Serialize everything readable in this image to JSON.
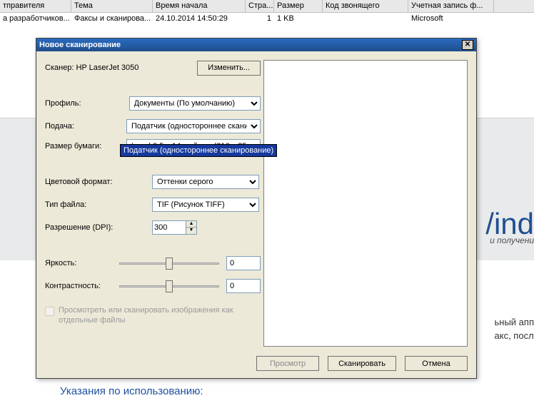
{
  "table": {
    "headers": {
      "sender": "тправителя",
      "subject": "Тема",
      "time": "Время начала",
      "pages": "Стра...",
      "size": "Размер",
      "caller": "Код звонящего",
      "account": "Учетная запись ф..."
    },
    "row": {
      "sender": "а разработчиков...",
      "subject": "Факсы и сканирова...",
      "time": "24.10.2014 14:50:29",
      "pages": "1",
      "size": "1 KB",
      "caller": "",
      "account": "Microsoft"
    }
  },
  "bg": {
    "winText": "/ind",
    "subText": "и получени",
    "para1": "ьный апп",
    "para2": "акс, посл",
    "instructions": "Указания по использованию:"
  },
  "dialog": {
    "title": "Новое сканирование",
    "scannerLabel": "Сканер:",
    "scannerValue": "HP LaserJet 3050",
    "changeBtn": "Изменить...",
    "profileLabel": "Профиль:",
    "profileValue": "Документы (По умолчанию)",
    "feedLabel": "Подача:",
    "feedValue": "Податчик (одностороннее скани",
    "feedOption": "Податчик (одностороннее сканирование)",
    "paperLabel": "Размер бумаги:",
    "paperValue": "Legal 8,5 x 14 дюймов (216 x 356 м",
    "colorLabel": "Цветовой формат:",
    "colorValue": "Оттенки серого",
    "fileLabel": "Тип файла:",
    "fileValue": "TIF (Рисунок TIFF)",
    "dpiLabel": "Разрешение (DPI):",
    "dpiValue": "300",
    "brightLabel": "Яркость:",
    "brightValue": "0",
    "contrastLabel": "Контрастность:",
    "contrastValue": "0",
    "checkboxLabel": "Просмотреть или сканировать изображения как отдельные файлы",
    "previewBtn": "Просмотр",
    "scanBtn": "Сканировать",
    "cancelBtn": "Отмена"
  }
}
